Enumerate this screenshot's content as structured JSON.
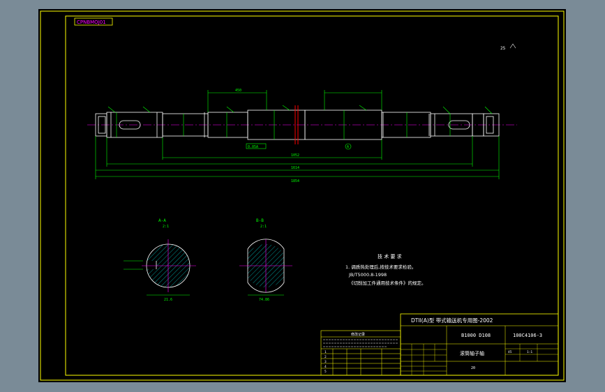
{
  "drawing": {
    "file_tag": "CPNBMOJ01",
    "scale_note": "25",
    "title_header": "DTII(A)型 带式输送机专用图-2002",
    "code_left": "B1000 D108",
    "code_right": "100C4106-3",
    "part_name": "滚筒轴子轴",
    "sheet_small": "20",
    "materials": [
      "45",
      "1:1"
    ]
  },
  "sections": {
    "section_a_label": "A-A",
    "section_a_scale": "2:1",
    "section_b_label": "B-B",
    "section_b_scale": "2:1",
    "section_a_dim": "21.6",
    "section_b_dim": "74.86"
  },
  "dimensions": {
    "overall": "1854",
    "second": "1614",
    "third": "1052",
    "top": "450",
    "tolerance_box": "0.05A",
    "datum": "A"
  },
  "tech_notes": {
    "title": "技 术 要 求",
    "line1": "1. 调质热处理后,按技术要求检验。",
    "line2": "JB/T5000.8-1998",
    "line3": "《切削加工件通用技术条件》的规定。"
  },
  "revision_table": {
    "header": "修改记录",
    "rows": [
      "1",
      "2",
      "3",
      "4",
      "5"
    ]
  },
  "colors": {
    "frame": "#ffff00",
    "outline": "#ffffff",
    "dimension": "#00ff00",
    "centerline": "#ff00ff",
    "section_mark": "#ff0000",
    "hatch": "#00ffff",
    "viewport_border": "#5a6a76"
  }
}
